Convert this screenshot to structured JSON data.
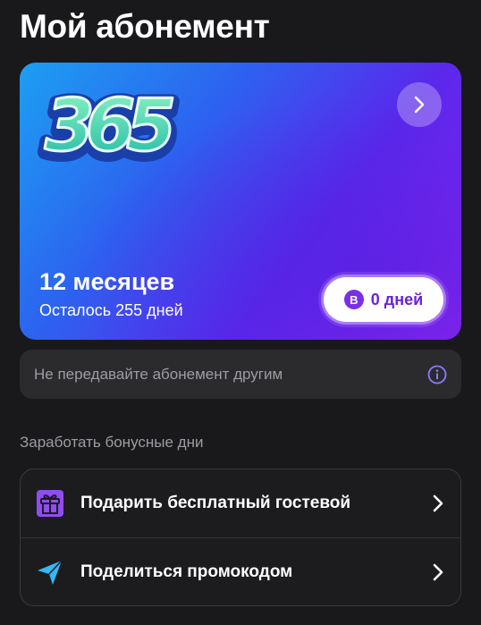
{
  "header": {
    "title": "Мой абонемент"
  },
  "subscription": {
    "logo_text": "365",
    "plan_name": "12 месяцев",
    "remaining": "Осталось 255 дней",
    "bonus_badge": "B",
    "bonus_days": "0 дней",
    "colors": {
      "gradient_start": "#1c9ff2",
      "gradient_end": "#8f24f0",
      "pill_text": "#6a22e0"
    }
  },
  "notice": {
    "text": "Не передавайте абонемент другим",
    "icon": "info-icon",
    "icon_color": "#8a7cff"
  },
  "bonus_section": {
    "label": "Заработать бонусные дни",
    "items": [
      {
        "label": "Подарить бесплатный гостевой",
        "icon": "gift-icon",
        "icon_color": "#8f4df0"
      },
      {
        "label": "Поделиться промокодом",
        "icon": "paper-plane-icon",
        "icon_color": "#38b6f5"
      }
    ]
  }
}
